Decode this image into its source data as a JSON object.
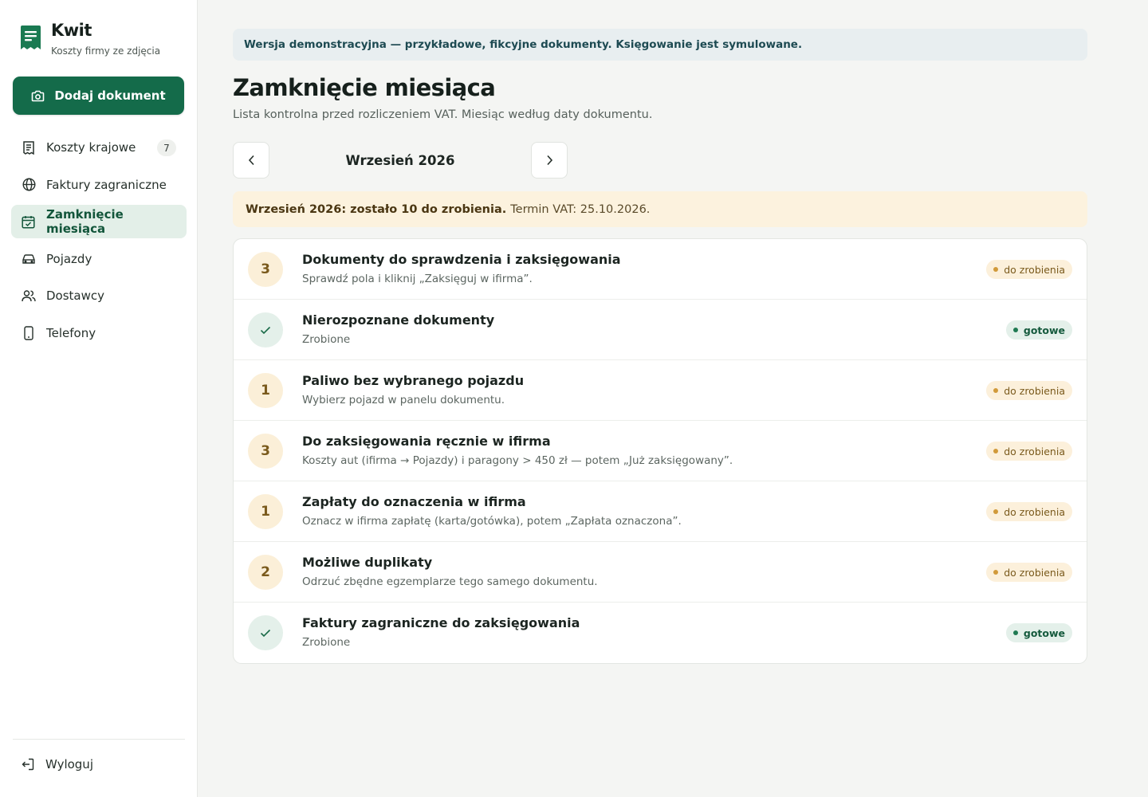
{
  "brand": {
    "name": "Kwit",
    "subtitle": "Koszty firmy ze zdjęcia"
  },
  "sidebar": {
    "add_button": "Dodaj dokument",
    "items": [
      {
        "label": "Koszty krajowe",
        "icon": "receipt-icon",
        "badge": "7"
      },
      {
        "label": "Faktury zagraniczne",
        "icon": "globe-icon"
      },
      {
        "label": "Zamknięcie miesiąca",
        "icon": "calendar-check-icon",
        "active": true
      },
      {
        "label": "Pojazdy",
        "icon": "car-icon"
      },
      {
        "label": "Dostawcy",
        "icon": "users-icon"
      },
      {
        "label": "Telefony",
        "icon": "phone-icon"
      }
    ],
    "logout": "Wyloguj"
  },
  "main": {
    "demo_banner": "Wersja demonstracyjna — przykładowe, fikcyjne dokumenty. Księgowanie jest symulowane.",
    "title": "Zamknięcie miesiąca",
    "subtitle": "Lista kontrolna przed rozliczeniem VAT. Miesiąc według daty dokumentu.",
    "month": "Wrzesień 2026",
    "warning": {
      "bold": "Wrzesień 2026: zostało 10 do zrobienia.",
      "rest": "Termin VAT: 25.10.2026."
    },
    "checklist": [
      {
        "count": "3",
        "status": "todo",
        "title": "Dokumenty do sprawdzenia i zaksięgowania",
        "desc": "Sprawdź pola i kliknij „Zaksięguj w ifirma”.",
        "pill": "do zrobienia"
      },
      {
        "count": "",
        "status": "done",
        "title": "Nierozpoznane dokumenty",
        "desc": "Zrobione",
        "pill": "gotowe"
      },
      {
        "count": "1",
        "status": "todo",
        "title": "Paliwo bez wybranego pojazdu",
        "desc": "Wybierz pojazd w panelu dokumentu.",
        "pill": "do zrobienia"
      },
      {
        "count": "3",
        "status": "todo",
        "title": "Do zaksięgowania ręcznie w ifirma",
        "desc": "Koszty aut (ifirma → Pojazdy) i paragony > 450 zł — potem „Już zaksięgowany”.",
        "pill": "do zrobienia"
      },
      {
        "count": "1",
        "status": "todo",
        "title": "Zapłaty do oznaczenia w ifirma",
        "desc": "Oznacz w ifirma zapłatę (karta/gotówka), potem „Zapłata oznaczona”.",
        "pill": "do zrobienia"
      },
      {
        "count": "2",
        "status": "todo",
        "title": "Możliwe duplikaty",
        "desc": "Odrzuć zbędne egzemplarze tego samego dokumentu.",
        "pill": "do zrobienia"
      },
      {
        "count": "",
        "status": "done",
        "title": "Faktury zagraniczne do zaksięgowania",
        "desc": "Zrobione",
        "pill": "gotowe"
      }
    ]
  },
  "colors": {
    "accent": "#146b4a",
    "todo": "#d19a3a",
    "done": "#1f7a52"
  }
}
